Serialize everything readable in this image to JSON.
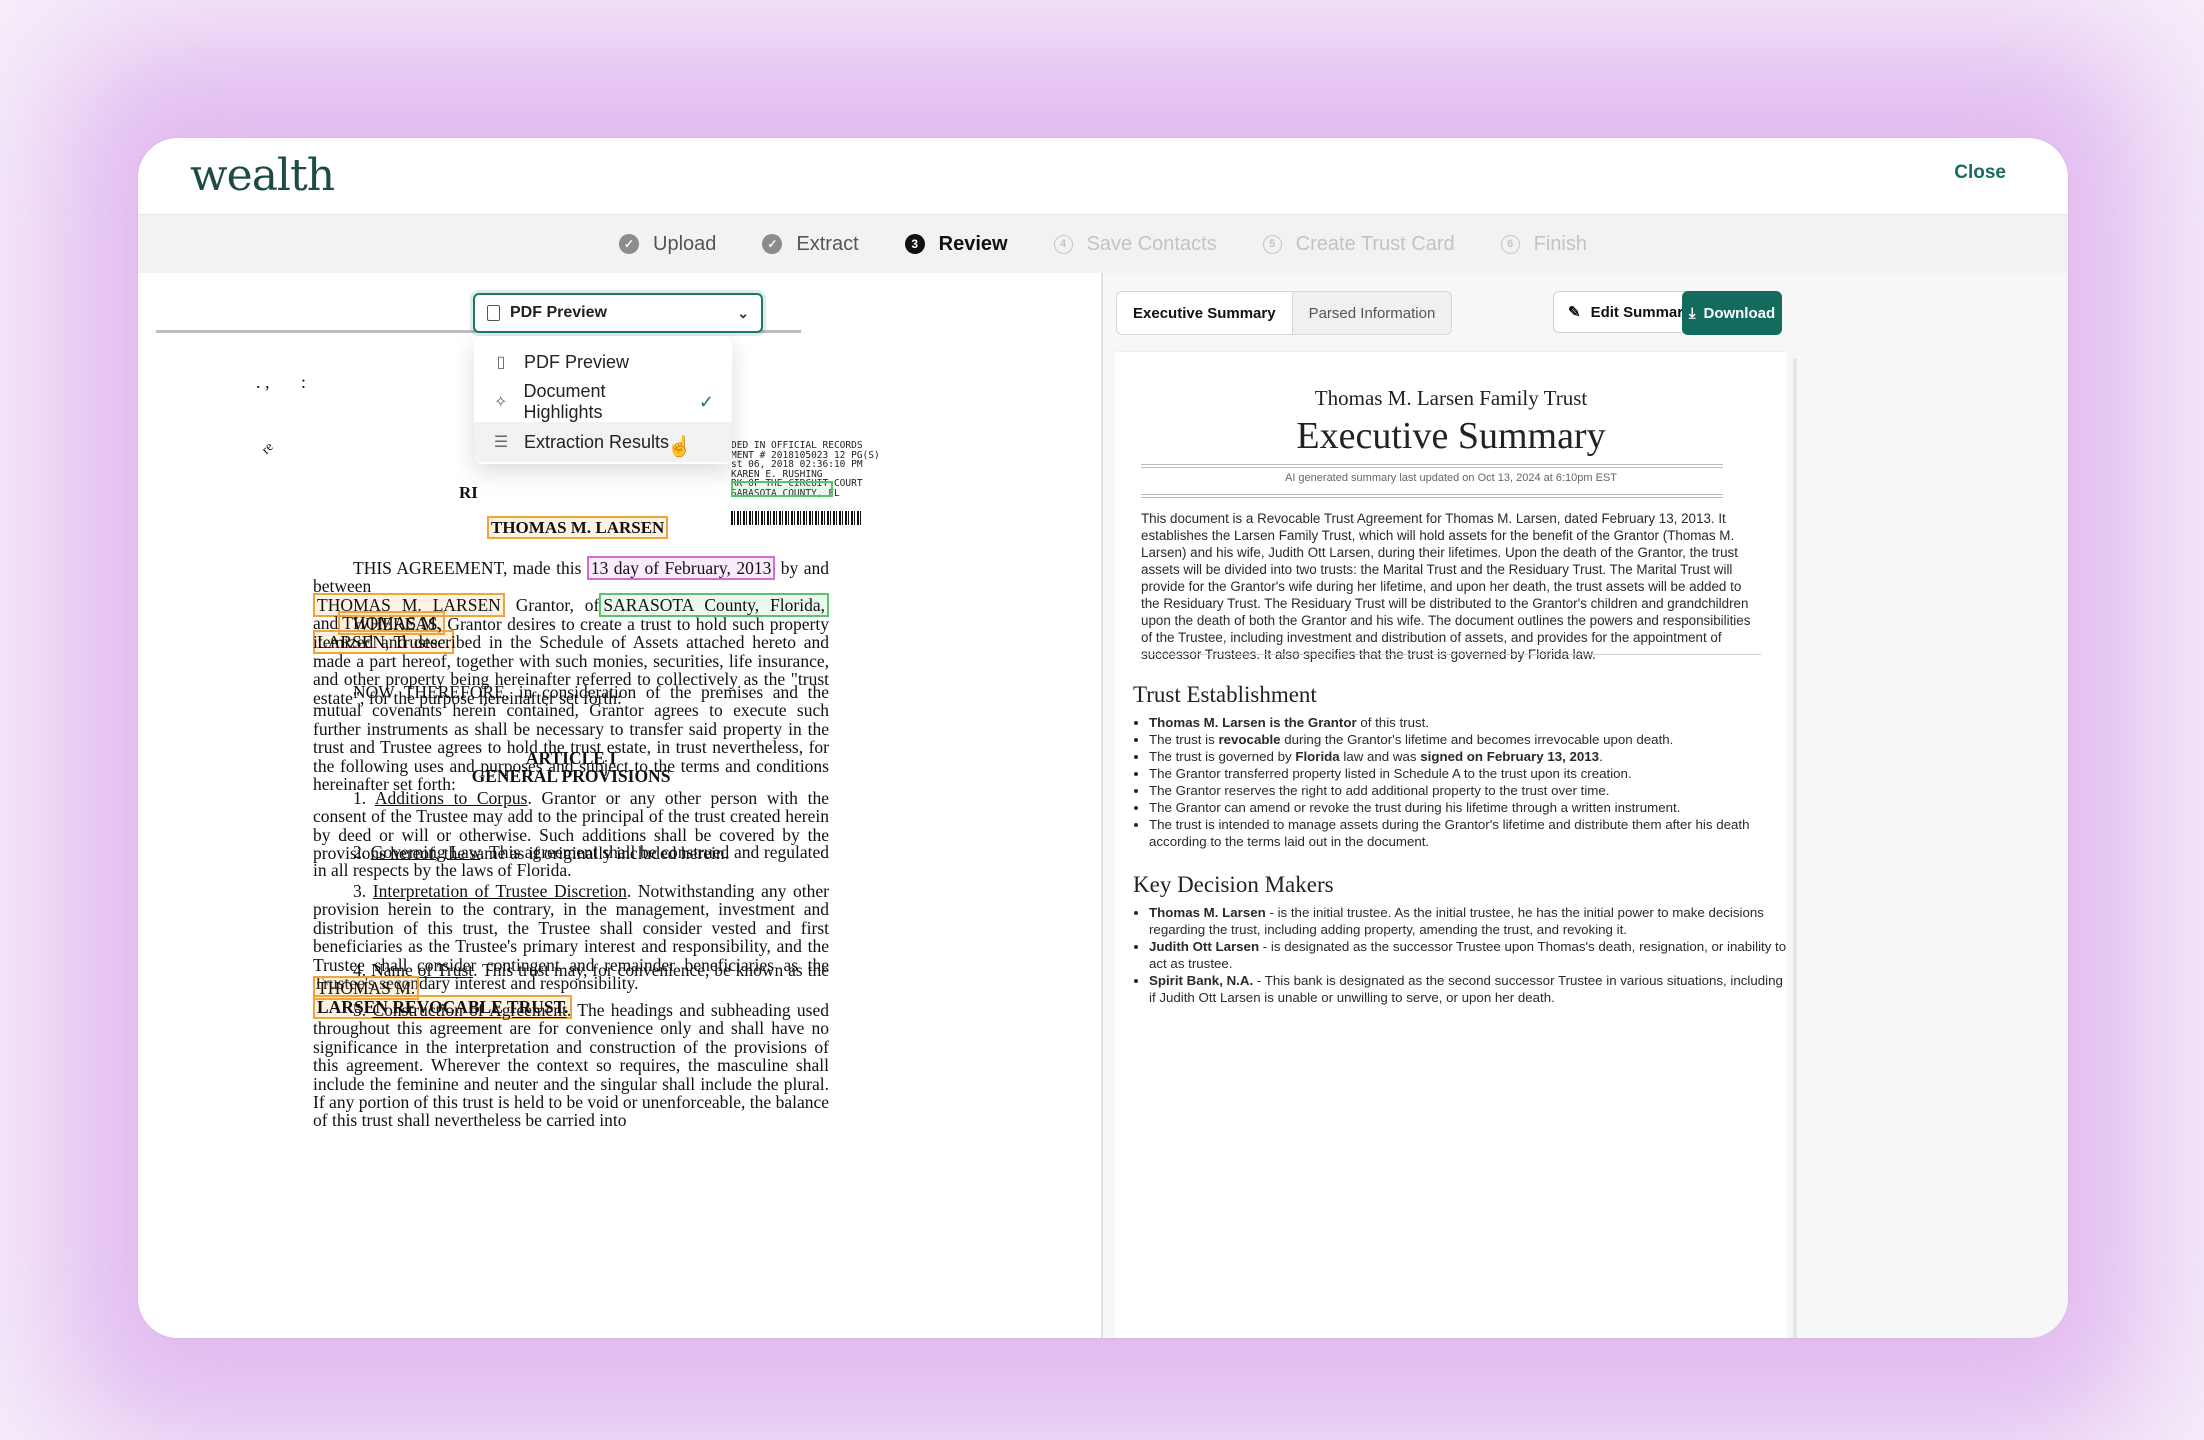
{
  "app": {
    "logo": "wealth",
    "close_label": "Close"
  },
  "steps": [
    {
      "num": "✓",
      "label": "Upload",
      "state": "done"
    },
    {
      "num": "✓",
      "label": "Extract",
      "state": "done"
    },
    {
      "num": "3",
      "label": "Review",
      "state": "active"
    },
    {
      "num": "4",
      "label": "Save Contacts",
      "state": "future"
    },
    {
      "num": "5",
      "label": "Create Trust Card",
      "state": "future"
    },
    {
      "num": "6",
      "label": "Finish",
      "state": "future"
    }
  ],
  "view_select": {
    "selected": "PDF Preview",
    "options": [
      {
        "label": "PDF Preview",
        "icon": "document-icon"
      },
      {
        "label": "Document Highlights",
        "icon": "sparkle-icon",
        "checked": true
      },
      {
        "label": "Extraction Results",
        "icon": "list-icon",
        "hovered": true
      }
    ]
  },
  "pdf": {
    "stamp": [
      "DED IN OFFICIAL RECORDS",
      "MENT # 2018105023  12 PG(S)",
      "st 06, 2018  02:36:10 PM",
      "  KAREN E. RUSHING",
      "RK OF THE CIRCUIT COURT",
      "SARASOTA COUNTY, FL"
    ],
    "heading_fragment": "RI",
    "name_hl": "THOMAS M. LARSEN",
    "agreement": {
      "pre": "THIS AGREEMENT, made this",
      "date_hl": "13  day of February, 2013",
      "post": "by and between",
      "grantor_hl": "THOMAS M. LARSEN",
      "grantor_of": "Grantor, of",
      "county_hl": "SARASOTA County, Florida,",
      "and": "and",
      "trustee_hl_1": "THOMAS M.",
      "trustee_hl_2": "LARSEN, Trustee."
    },
    "whereas": "WHEREAS, Grantor desires to create a trust to hold such property itemized and described in the Schedule of Assets attached hereto and made a part hereof, together with such monies, securities, life insurance, and other property being hereinafter referred to collectively as the \"trust estate\", for the purpose hereinafter set forth:",
    "now_therefore": "NOW THEREFORE, in consideration of the premises and the mutual covenants herein contained, Grantor agrees to execute such further instruments as shall be necessary to transfer said property in the trust and Trustee agrees to hold the trust estate, in trust nevertheless, for the following uses and purposes and subject to the terms and conditions hereinafter set forth:",
    "article": "ARTICLE I",
    "article_sub": "GENERAL PROVISIONS",
    "p1_title": "Additions to Corpus",
    "p1": ". Grantor or any other person with the consent of the Trustee may add to the principal of the trust created herein by deed or will or otherwise. Such additions shall be covered by the provisions hereof, the same as if originally included herein.",
    "p2_title": "Governing Law",
    "p2": ". This agreement shall be construed and regulated in all respects by the laws of Florida.",
    "p3_title": "Interpretation of Trustee Discretion",
    "p3": ". Notwithstanding any other provision herein to the contrary, in the management, investment and distribution of this trust, the Trustee shall consider vested and first beneficiaries as the Trustee's primary interest and responsibility, and the Trustee shall consider contingent and remainder beneficiaries as the Trustee's secondary interest and responsibility.",
    "p4_title": "Name of Trust",
    "p4": ". This trust may, for convenience, be known as the",
    "p4_hl_1": "THOMAS M.",
    "p4_hl_2": "LARSEN REVOCABLE TRUST.",
    "p5_title": "Construction of Agreement",
    "p5": ". The headings and subheading used throughout this agreement are for convenience only and shall have no significance in the interpretation and construction of the provisions of this agreement. Wherever the context so requires, the masculine shall include the feminine and neuter and the singular shall include the plural. If any portion of this trust is held to be void or unenforceable, the balance of this trust shall nevertheless be carried into"
  },
  "summary": {
    "tabs": [
      "Executive Summary",
      "Parsed Information"
    ],
    "edit_label": "Edit Summary",
    "download_label": "Download",
    "trust_name": "Thomas M. Larsen Family Trust",
    "title": "Executive Summary",
    "meta": "AI generated summary last updated on Oct 13, 2024 at 6:10pm EST",
    "body": "This document is a Revocable Trust Agreement for Thomas M. Larsen, dated February 13, 2013. It establishes the Larsen Family Trust, which will hold assets for the benefit of the Grantor (Thomas M. Larsen) and his wife, Judith Ott Larsen, during their lifetimes. Upon the death of the Grantor, the trust assets will be divided into two trusts: the Marital Trust and the Residuary Trust. The Marital Trust will provide for the Grantor's wife during her lifetime, and upon her death, the trust assets will be added to the Residuary Trust. The Residuary Trust will be distributed to the Grantor's children and grandchildren upon the death of both the Grantor and his wife. The document outlines the powers and responsibilities of the Trustee, including investment and distribution of assets, and provides for the appointment of successor Trustees. It also specifies that the trust is governed by Florida law.",
    "sec1": "Trust Establishment",
    "sec1_items": [
      {
        "bold": "Thomas M. Larsen is the Grantor",
        "text": " of this trust."
      },
      {
        "pre": "The trust is ",
        "bold": "revocable",
        "text": " during the Grantor's lifetime and becomes irrevocable upon death."
      },
      {
        "pre": "The trust is governed by ",
        "bold": "Florida",
        "text": " law and was ",
        "bold2": "signed on February 13, 2013",
        "text2": "."
      },
      {
        "text": "The Grantor transferred property listed in Schedule A to the trust upon its creation."
      },
      {
        "text": "The Grantor reserves the right to add additional property to the trust over time."
      },
      {
        "text": "The Grantor can amend or revoke the trust during his lifetime through a written instrument."
      },
      {
        "text": "The trust is intended to manage assets during the Grantor's lifetime and distribute them after his death according to the terms laid out in the document."
      }
    ],
    "sec2": "Key Decision Makers",
    "sec2_items": [
      {
        "bold": "Thomas M. Larsen",
        "text": " - is the initial trustee.  As the initial trustee, he has the initial power to make decisions regarding the trust, including adding property, amending the trust, and revoking it."
      },
      {
        "bold": "Judith Ott Larsen",
        "text": " - is designated as the successor Trustee upon Thomas's death, resignation, or inability to act as trustee."
      },
      {
        "bold": "Spirit Bank, N.A.",
        "text": " - This bank is designated as the second successor Trustee in various situations, including if Judith Ott Larsen is unable or unwilling to serve, or upon her death."
      }
    ]
  }
}
